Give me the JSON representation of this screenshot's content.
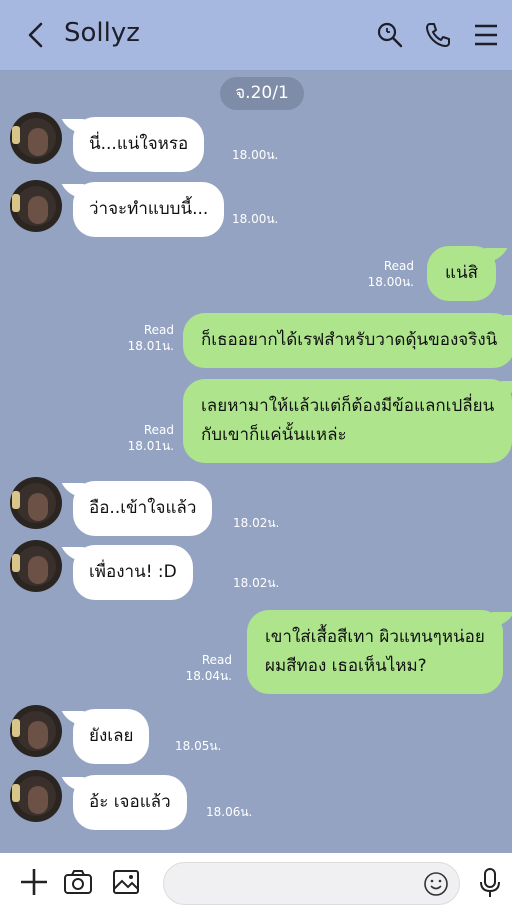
{
  "header": {
    "title": "Sollyz",
    "icons": [
      "back-icon",
      "search-icon",
      "phone-icon",
      "menu-icon"
    ]
  },
  "date_separator": "จ.20/1",
  "messages": [
    {
      "side": "in",
      "lines": [
        "นี่...แน่ใจหรอ"
      ],
      "time": "18.00น."
    },
    {
      "side": "in",
      "lines": [
        "ว่าจะทำแบบนี้..."
      ],
      "time": "18.00น."
    },
    {
      "side": "out",
      "lines": [
        "แน่สิ"
      ],
      "read": "Read",
      "time": "18.00น."
    },
    {
      "side": "out",
      "lines": [
        "ก็เธออยากได้เรฟสำหรับวาดดุ้นของจริงนิ"
      ],
      "read": "Read",
      "time": "18.01น."
    },
    {
      "side": "out",
      "lines": [
        "เลยหามาให้แล้วแต่ก็ต้องมีข้อแลกเปลี่ยน",
        "กับเขาก็แค่นั้นแหล่ะ"
      ],
      "read": "Read",
      "time": "18.01น."
    },
    {
      "side": "in",
      "lines": [
        "อือ..เข้าใจแล้ว"
      ],
      "time": "18.02น."
    },
    {
      "side": "in",
      "lines": [
        "เพื่องาน! :D"
      ],
      "time": "18.02น."
    },
    {
      "side": "out",
      "lines": [
        "เขาใส่เสื้อสีเทา ผิวแทนๆหน่อย",
        "ผมสีทอง เธอเห็นไหม?"
      ],
      "read": "Read",
      "time": "18.04น."
    },
    {
      "side": "in",
      "lines": [
        "ยังเลย"
      ],
      "time": "18.05น."
    },
    {
      "side": "in",
      "lines": [
        "อ้ะ เจอแล้ว"
      ],
      "time": "18.06น."
    }
  ],
  "bottom_bar": {
    "icons": [
      "plus-icon",
      "camera-icon",
      "image-icon",
      "emoji-icon",
      "microphone-icon"
    ],
    "input_placeholder": ""
  },
  "colors": {
    "background": "#94a3c2",
    "header": "#a6b7e0",
    "incoming_bubble": "#ffffff",
    "outgoing_bubble": "#aee58c",
    "date_pill": "#7f8ca8"
  }
}
